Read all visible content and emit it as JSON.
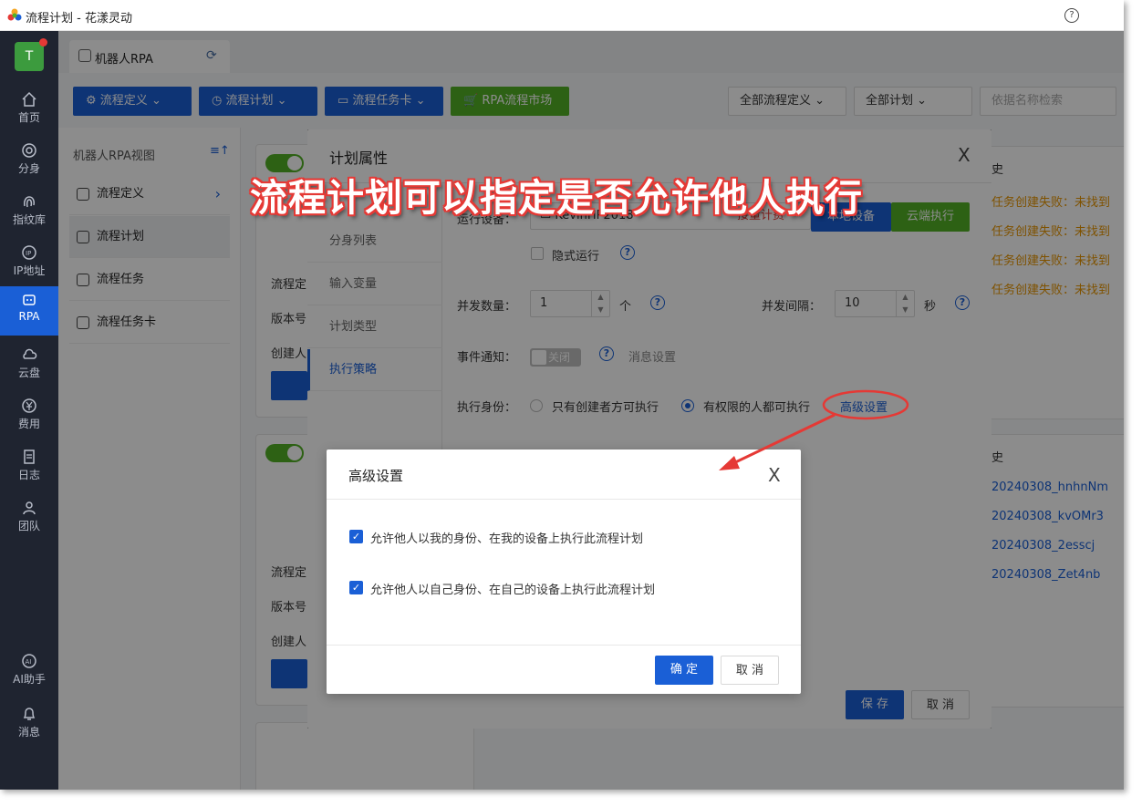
{
  "window": {
    "title": "流程计划 - 花漾灵动",
    "help": "?"
  },
  "nav": {
    "avatar": "T",
    "items": [
      {
        "label": "首页"
      },
      {
        "label": "分身"
      },
      {
        "label": "指纹库"
      },
      {
        "label": "IP地址"
      },
      {
        "label": "RPA"
      },
      {
        "label": "云盘"
      },
      {
        "label": "费用"
      },
      {
        "label": "日志"
      },
      {
        "label": "团队"
      }
    ],
    "bottom": [
      {
        "label": "AI助手"
      },
      {
        "label": "消息"
      }
    ]
  },
  "tab": {
    "label": "机器人RPA"
  },
  "toolbar": {
    "btn1": "流程定义",
    "btn2": "流程计划",
    "btn3": "流程任务卡",
    "btn4": "RPA流程市场",
    "select1": "全部流程定义",
    "select2": "全部计划",
    "search_placeholder": "依据名称检索"
  },
  "sidebar": {
    "header": "机器人RPA视图",
    "items": [
      {
        "label": "流程定义"
      },
      {
        "label": "流程计划"
      },
      {
        "label": "流程任务"
      },
      {
        "label": "流程任务卡"
      }
    ]
  },
  "cards": {
    "rows1": [
      "流程定",
      "版本号",
      "创建人"
    ],
    "rows2": [
      "流程定",
      "版本号",
      "创建人"
    ]
  },
  "right_panel": {
    "title1": "史",
    "logs": [
      "任务创建失败：未找到",
      "任务创建失败：未找到",
      "任务创建失败：未找到",
      "任务创建失败：未找到"
    ],
    "title2": "史",
    "links": [
      "20240308_hnhnNm",
      "20240308_kvOMr3",
      "20240308_2esscj",
      "20240308_Zet4nb"
    ]
  },
  "plan_dialog": {
    "title": "计划属性",
    "close": "X",
    "tabs": [
      "分身列表",
      "输入变量",
      "计划类型",
      "执行策略"
    ],
    "device_label": "运行设备：",
    "device_value": "KevinHP2018",
    "device_status": "接量计费",
    "btn_local": "本地设备",
    "btn_cloud": "云端执行",
    "hidden_run": "隐式运行",
    "concurrency_label": "并发数量：",
    "concurrency_value": "1",
    "concurrency_unit": "个",
    "interval_label": "并发间隔：",
    "interval_value": "10",
    "interval_unit": "秒",
    "event_label": "事件通知：",
    "event_switch": "关闭",
    "event_link": "消息设置",
    "identity_label": "执行身份：",
    "identity_opt1": "只有创建者方可执行",
    "identity_opt2": "有权限的人都可执行",
    "advanced_link": "高级设置",
    "save": "保 存",
    "cancel": "取 消"
  },
  "advanced_dialog": {
    "title": "高级设置",
    "close": "X",
    "opt1": "允许他人以我的身份、在我的设备上执行此流程计划",
    "opt2": "允许他人以自己身份、在自己的设备上执行此流程计划",
    "ok": "确 定",
    "cancel": "取 消"
  },
  "annotation": {
    "banner": "流程计划可以指定是否允许他人执行",
    "color": "#e53935"
  }
}
